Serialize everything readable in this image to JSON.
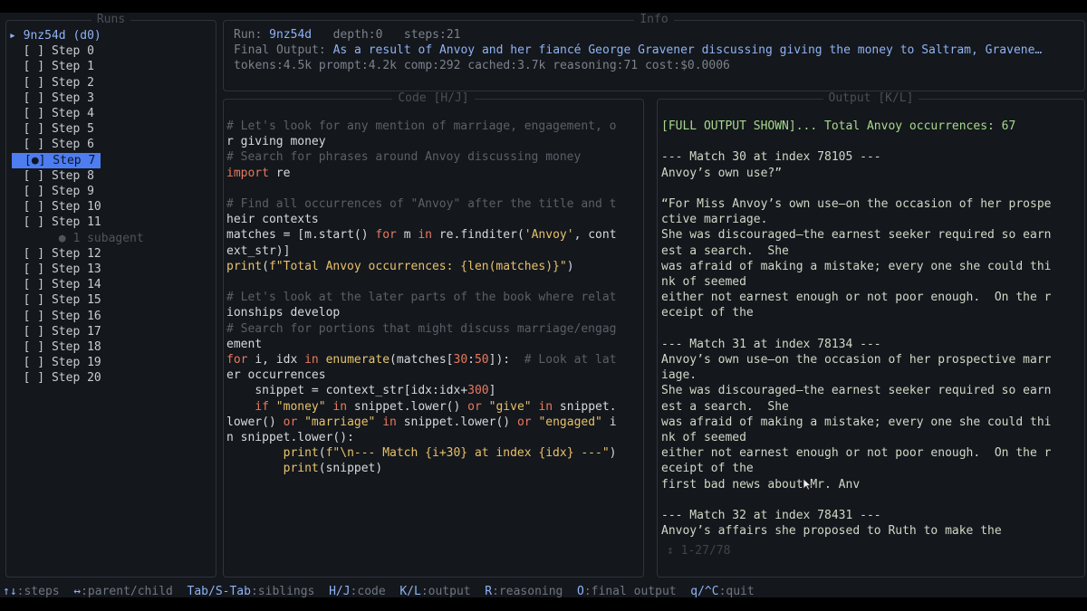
{
  "panels": {
    "runs_title": "Runs",
    "info_title": "Info",
    "code_title": "Code [H/J]",
    "output_title": "Output [K/L]"
  },
  "runs": {
    "root": "▸ 9nz54d (d0)",
    "steps": [
      "[ ] Step 0",
      "[ ] Step 1",
      "[ ] Step 2",
      "[ ] Step 3",
      "[ ] Step 4",
      "[ ] Step 5",
      "[ ] Step 6",
      "[●] Step 7",
      "[ ] Step 8",
      "[ ] Step 9",
      "[ ] Step 10",
      "[ ] Step 11"
    ],
    "subagent": "● 1 subagent",
    "steps_after": [
      "[ ] Step 12",
      "[ ] Step 13",
      "[ ] Step 14",
      "[ ] Step 15",
      "[ ] Step 16",
      "[ ] Step 17",
      "[ ] Step 18",
      "[ ] Step 19",
      "[ ] Step 20"
    ],
    "selected_index": 7
  },
  "info": {
    "run_label": "Run:",
    "run_id": "9nz54d",
    "depth_label": "depth:",
    "depth": "0",
    "steps_label": "steps:",
    "steps": "21",
    "final_label": "Final Output:",
    "final_text": "As a result of Anvoy and her fiancé George Gravener discussing giving the money to Saltram, Gravene…",
    "tokens": "tokens:4.5k prompt:4.2k comp:292 cached:3.7k reasoning:71 cost:$0.0006"
  },
  "code_lines": [
    "# Let's look for any mention of marriage, engagement, o",
    "r giving money",
    "# Search for phrases around Anvoy discussing money",
    "import re",
    "",
    "# Find all occurrences of \"Anvoy\" after the title and t",
    "heir contexts",
    "matches = [m.start() for m in re.finditer('Anvoy', cont",
    "ext_str)]",
    "print(f\"Total Anvoy occurrences: {len(matches)}\")",
    "",
    "# Let's look at the later parts of the book where relat",
    "ionships develop",
    "# Search for portions that might discuss marriage/engag",
    "ement",
    "for i, idx in enumerate(matches[30:50]):  # Look at lat",
    "er occurrences",
    "    snippet = context_str[idx:idx+300]",
    "    if \"money\" in snippet.lower() or \"give\" in snippet.",
    "lower() or \"marriage\" in snippet.lower() or \"engaged\" i",
    "n snippet.lower():",
    "        print(f\"\\n--- Match {i+30} at index {idx} ---\")",
    "        print(snippet)"
  ],
  "output_lines": [
    "[FULL OUTPUT SHOWN]... Total Anvoy occurrences: 67",
    "",
    "--- Match 30 at index 78105 ---",
    "Anvoy’s own use?”",
    "",
    "“For Miss Anvoy’s own use—on the occasion of her prospe",
    "ctive marriage.",
    "She was discouraged—the earnest seeker required so earn",
    "est a search.  She",
    "was afraid of making a mistake; every one she could thi",
    "nk of seemed",
    "either not earnest enough or not poor enough.  On the r",
    "eceipt of the",
    "",
    "--- Match 31 at index 78134 ---",
    "Anvoy’s own use—on the occasion of her prospective marr",
    "iage.",
    "She was discouraged—the earnest seeker required so earn",
    "est a search.  She",
    "was afraid of making a mistake; every one she could thi",
    "nk of seemed",
    "either not earnest enough or not poor enough.  On the r",
    "eceipt of the",
    "first bad news about Mr. Anv",
    "",
    "--- Match 32 at index 78431 ---",
    "Anvoy’s affairs she proposed to Ruth to make the"
  ],
  "output_scroll": "↕ 1-27/78",
  "statusbar": [
    {
      "key": "↑↓",
      "desc": ":steps  "
    },
    {
      "key": "↔",
      "desc": ":parent/child  "
    },
    {
      "key": "Tab/S-Tab",
      "desc": ":siblings  "
    },
    {
      "key": "H/J",
      "desc": ":code  "
    },
    {
      "key": "K/L",
      "desc": ":output  "
    },
    {
      "key": "R",
      "desc": ":reasoning  "
    },
    {
      "key": "O",
      "desc": ":final output  "
    },
    {
      "key": "q/^C",
      "desc": ":quit"
    }
  ],
  "colors": {
    "background": "#14171c",
    "accent": "#8fb3f5",
    "selection": "#4d7df0",
    "keyword": "#e8795f",
    "string": "#e7c06a",
    "comment": "#5a6068"
  }
}
